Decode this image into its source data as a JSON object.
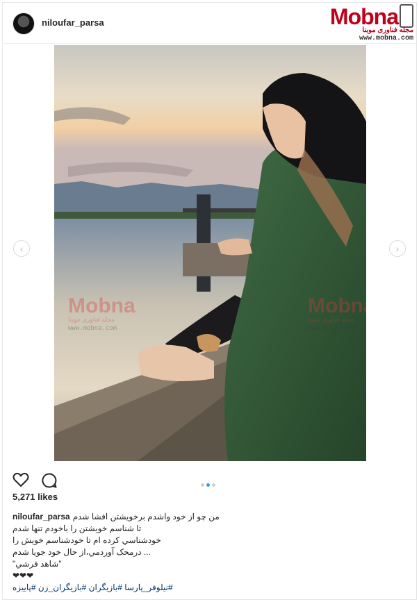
{
  "post": {
    "username": "niloufar_parsa",
    "likes": "5,271 likes",
    "carousel_index": 2,
    "carousel_total": 3,
    "caption_lines": [
      "من چو از خود واشدم برخویشتن افشا شدم",
      "تا شناسم خویشتن را باخودم تنها شدم",
      "خودشناسي کرده ام تا خودشناسم خویش را",
      "... درمحک آوردمي،از حال خود جویا شدم",
      "\"شاهد فرشي\""
    ],
    "hearts": "❤❤❤",
    "hashtags": "#نيلوفر_پارسا #بازیگران #بازیگران_زن #پاییزه"
  },
  "logo": {
    "word": "Mobna",
    "subtitle": "مجله فناوری موبنا",
    "url": "www.mobna.com",
    "brand_color": "#c0001a"
  },
  "watermark": {
    "word": "Mobna",
    "subtitle": "مجله فناوری موبنا",
    "url": "www.mobna.com"
  },
  "icons": {
    "like": "heart-icon",
    "comment": "comment-icon",
    "prev": "chevron-left-icon",
    "next": "chevron-right-icon"
  },
  "colors": {
    "link": "#003569",
    "active_dot": "#3897f0"
  }
}
